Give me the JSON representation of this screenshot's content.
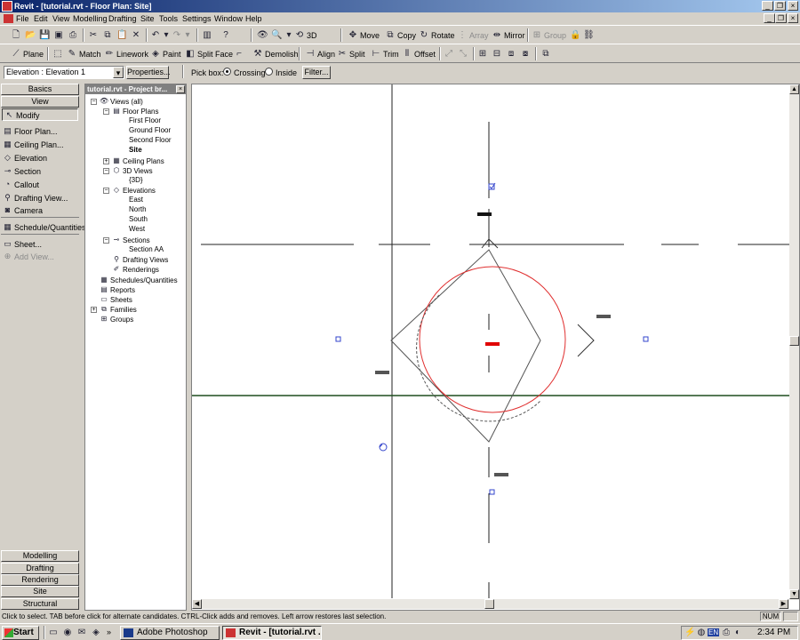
{
  "window": {
    "title": "Revit - [tutorial.rvt - Floor Plan: Site]"
  },
  "menu": [
    "File",
    "Edit",
    "View",
    "Modelling",
    "Drafting",
    "Site",
    "Tools",
    "Settings",
    "Window",
    "Help"
  ],
  "toolbar1": {
    "three_d": "3D",
    "move": "Move",
    "copy": "Copy",
    "rotate": "Rotate",
    "array": "Array",
    "mirror": "Mirror",
    "group": "Group"
  },
  "toolbar2": {
    "plane": "Plane",
    "match": "Match",
    "linework": "Linework",
    "paint": "Paint",
    "split_face": "Split Face",
    "demolish": "Demolish",
    "align": "Align",
    "split": "Split",
    "trim": "Trim",
    "offset": "Offset"
  },
  "options_bar": {
    "type_selector": "Elevation : Elevation 1",
    "properties": "Properties...",
    "pick_box_label": "Pick box:",
    "crossing": "Crossing",
    "inside": "Inside",
    "filter": "Filter..."
  },
  "design_bar": {
    "tab_basics": "Basics",
    "tab_view": "View",
    "items": [
      "Modify",
      "Floor Plan...",
      "Ceiling Plan...",
      "Elevation",
      "Section",
      "Callout",
      "Drafting View...",
      "Camera",
      "Schedule/Quantities...",
      "Sheet...",
      "Add View..."
    ],
    "bottom_tabs": [
      "Modelling",
      "Drafting",
      "Rendering",
      "Site",
      "Structural"
    ]
  },
  "project_browser": {
    "title": "tutorial.rvt - Project br...",
    "root": "Views (all)",
    "floor_plans": "Floor Plans",
    "floor_plan_items": [
      "First Floor",
      "Ground Floor",
      "Second Floor",
      "Site"
    ],
    "ceiling_plans": "Ceiling Plans",
    "views_3d": "3D Views",
    "views_3d_items": [
      "{3D}"
    ],
    "elevations": "Elevations",
    "elevation_items": [
      "East",
      "North",
      "South",
      "West"
    ],
    "sections": "Sections",
    "section_items": [
      "Section AA"
    ],
    "drafting_views": "Drafting Views",
    "renderings": "Renderings",
    "schedules": "Schedules/Quantities",
    "reports": "Reports",
    "sheets": "Sheets",
    "families": "Families",
    "groups": "Groups"
  },
  "status_bar": {
    "message": "Click to select. TAB before click for alternate candidates. CTRL-Click adds and removes. Left arrow restores last selection.",
    "num": "NUM"
  },
  "taskbar": {
    "start": "Start",
    "tasks": [
      "Adobe Photoshop",
      "Revit - [tutorial.rvt ..."
    ],
    "tray_lang": "EN",
    "clock": "2:34 PM"
  },
  "colors": {
    "title_gradient_start": "#0a246a",
    "title_gradient_end": "#a6caf0",
    "circle": "#e03030",
    "horizontal_line": "#1e4d1e",
    "selected_marker": "#e00000"
  }
}
